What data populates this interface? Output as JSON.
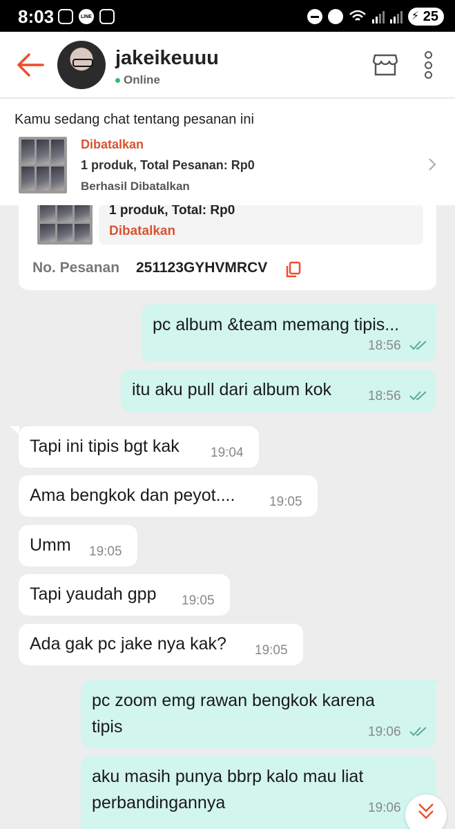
{
  "status_bar": {
    "time": "8:03",
    "battery": "25",
    "network": "5"
  },
  "header": {
    "contact_name": "jakeikeuuu",
    "presence": "Online"
  },
  "order_banner": {
    "title": "Kamu sedang chat tentang pesanan ini",
    "status": "Dibatalkan",
    "summary": "1 produk, Total Pesanan: Rp0",
    "sub_status": "Berhasil Dibatalkan"
  },
  "order_card": {
    "summary": "1 produk, Total: Rp0",
    "status": "Dibatalkan",
    "order_no_label": "No. Pesanan",
    "order_no": "251123GYHVMRCV"
  },
  "messages": [
    {
      "direction": "out",
      "text": "pc album &team memang tipis...",
      "time": "18:56"
    },
    {
      "direction": "out",
      "text": "itu aku pull dari album kok",
      "time": "18:56"
    },
    {
      "direction": "in",
      "text": "Tapi ini tipis bgt kak",
      "time": "19:04"
    },
    {
      "direction": "in",
      "text": "Ama bengkok dan peyot....",
      "time": "19:05"
    },
    {
      "direction": "in",
      "text": "Umm",
      "time": "19:05"
    },
    {
      "direction": "in",
      "text": "Tapi yaudah gpp",
      "time": "19:05"
    },
    {
      "direction": "in",
      "text": "Ada gak pc jake nya kak?",
      "time": "19:05"
    },
    {
      "direction": "out",
      "text_line1": "pc zoom emg rawan bengkok karena",
      "text_line2": "tipis",
      "time": "19:06"
    },
    {
      "direction": "out",
      "text_line1": "aku masih punya bbrp kalo mau liat",
      "text_line2": "perbandingannya",
      "time": "19:06"
    }
  ],
  "colors": {
    "accent": "#ee4d2d",
    "outgoing_bubble": "#d2f5ee",
    "incoming_bubble": "#ffffff",
    "background": "#ededed",
    "status_red": "#d9532f"
  }
}
